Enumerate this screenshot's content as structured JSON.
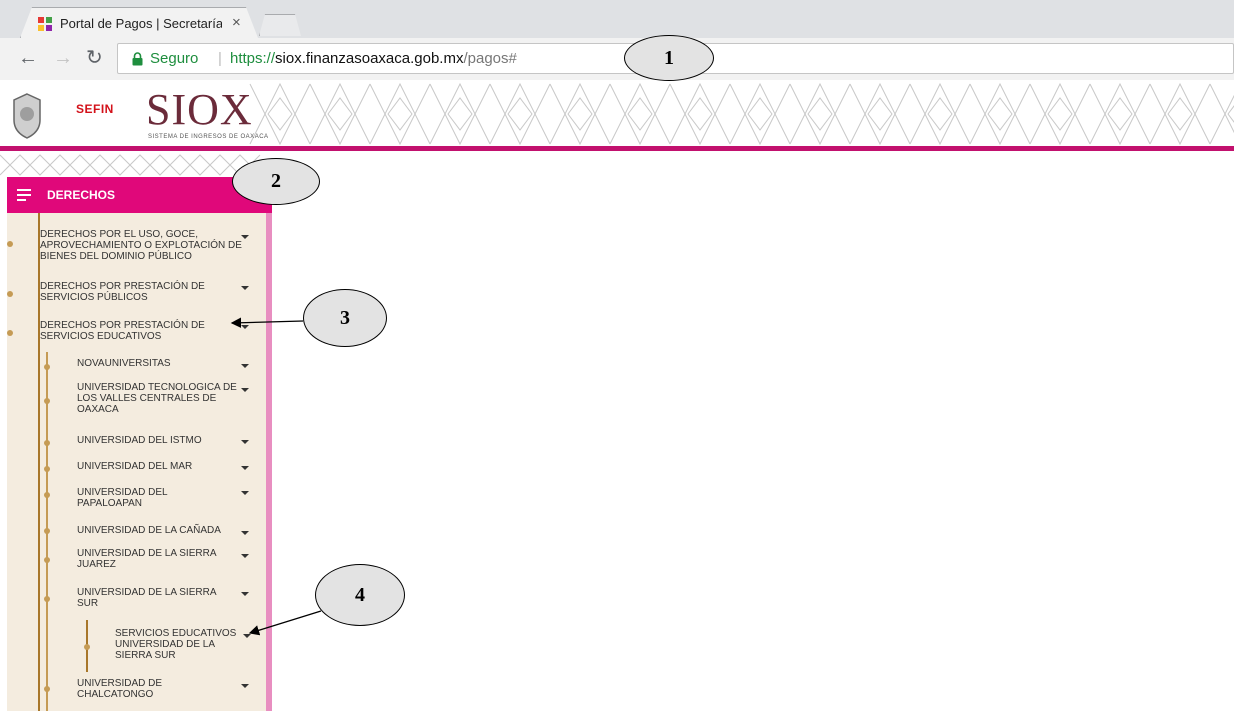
{
  "browser": {
    "tab_title": "Portal de Pagos | Secretaría",
    "tab_close": "×",
    "url_secure_label": "Seguro",
    "url_proto": "https://",
    "url_host": "siox.finanzasoaxaca.gob.mx",
    "url_path": "/pagos#"
  },
  "header": {
    "sefin_logo_text": "SEFIN",
    "siox_logo_text": "SIOX",
    "siox_subtitle": "SISTEMA DE INGRESOS DE OAXACA"
  },
  "sidebar": {
    "section_title": "DERECHOS",
    "items": [
      {
        "label": "DERECHOS POR EL USO, GOCE, APROVECHAMIENTO O EXPLOTACIÓN DE BIENES DEL DOMINIO PÚBLICO"
      },
      {
        "label": "DERECHOS POR PRESTACIÓN DE SERVICIOS PÚBLICOS"
      },
      {
        "label": "DERECHOS POR PRESTACIÓN DE SERVICIOS EDUCATIVOS"
      }
    ],
    "subitems": [
      {
        "label": "NOVAUNIVERSITAS"
      },
      {
        "label": "UNIVERSIDAD TECNOLOGICA DE LOS VALLES CENTRALES DE OAXACA"
      },
      {
        "label": "UNIVERSIDAD DEL ISTMO"
      },
      {
        "label": "UNIVERSIDAD DEL MAR"
      },
      {
        "label": "UNIVERSIDAD DEL PAPALOAPAN"
      },
      {
        "label": "UNIVERSIDAD DE LA CAÑADA"
      },
      {
        "label": "UNIVERSIDAD DE LA SIERRA JUAREZ"
      },
      {
        "label": "UNIVERSIDAD DE LA SIERRA SUR"
      },
      {
        "label": "UNIVERSIDAD DE CHALCATONGO"
      }
    ],
    "subsubitems": [
      {
        "label": "SERVICIOS EDUCATIVOS UNIVERSIDAD DE LA SIERRA SUR"
      }
    ]
  },
  "annotations": {
    "c1": "1",
    "c2": "2",
    "c3": "3",
    "c4": "4"
  },
  "colors": {
    "accent": "#e0087a",
    "menu_bg": "#f4ecdf",
    "secure_green": "#1e8e3e"
  }
}
